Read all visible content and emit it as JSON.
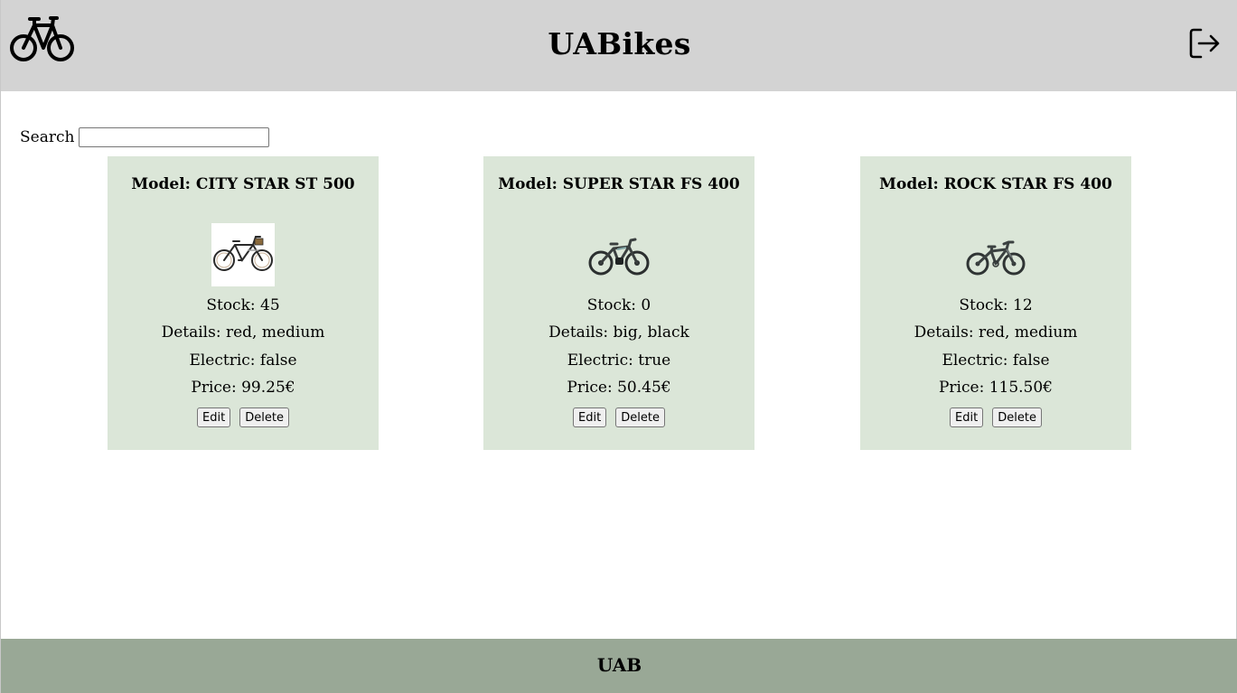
{
  "header": {
    "title": "UABikes",
    "logo_icon": "bicycle-icon",
    "logout_icon": "logout-icon",
    "background": "#d3d3d3"
  },
  "search": {
    "label": "Search",
    "value": "",
    "placeholder": ""
  },
  "bikes": [
    {
      "model": "Model: CITY STAR ST 500",
      "image_icon": "city-bike-photo",
      "stock": "Stock: 45",
      "details": "Details: red, medium",
      "electric": "Electric: false",
      "price": "Price: 99.25€",
      "edit_label": "Edit",
      "delete_label": "Delete"
    },
    {
      "model": "Model: SUPER STAR FS 400",
      "image_icon": "e-bike-photo",
      "stock": "Stock: 0",
      "details": "Details: big, black",
      "electric": "Electric: true",
      "price": "Price: 50.45€",
      "edit_label": "Edit",
      "delete_label": "Delete"
    },
    {
      "model": "Model: ROCK STAR FS 400",
      "image_icon": "mountain-bike-photo",
      "stock": "Stock: 12",
      "details": "Details: red, medium",
      "electric": "Electric: false",
      "price": "Price: 115.50€",
      "edit_label": "Edit",
      "delete_label": "Delete"
    }
  ],
  "card_background": "#dbe6d8",
  "footer": {
    "text": "UAB",
    "background": "#99a896"
  }
}
